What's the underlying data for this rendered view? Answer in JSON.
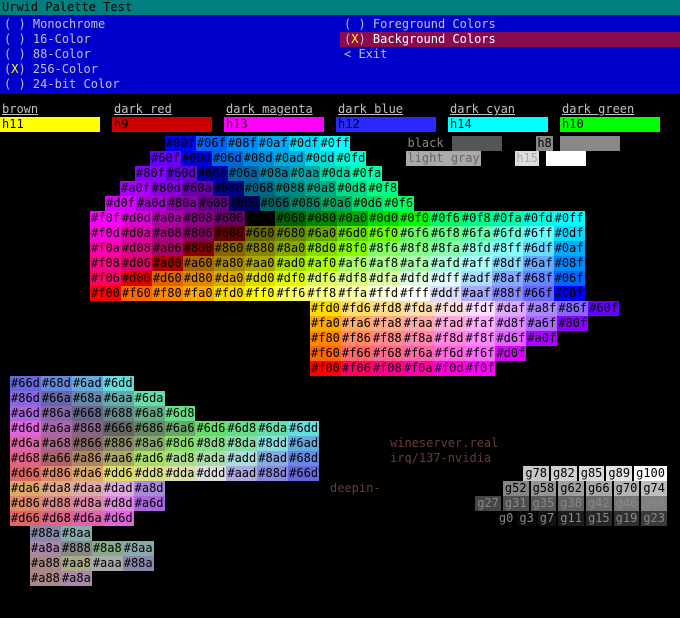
{
  "title": "Urwid Palette Test",
  "menu": {
    "left": [
      {
        "mark": " ",
        "label": "Monochrome"
      },
      {
        "mark": " ",
        "label": "16-Color"
      },
      {
        "mark": " ",
        "label": "88-Color"
      },
      {
        "mark": "X",
        "label": "256-Color"
      },
      {
        "mark": " ",
        "label": "24-bit Color"
      }
    ],
    "right": [
      {
        "mark": " ",
        "label": "Foreground Colors",
        "sel": false
      },
      {
        "mark": "X",
        "label": "Background Colors",
        "sel": true
      },
      {
        "exit": "Exit"
      }
    ]
  },
  "swatches": [
    {
      "name": "brown",
      "code": "h11",
      "bg": "#ffff00"
    },
    {
      "name": "dark red",
      "code": "h9",
      "bg": "#cd0000"
    },
    {
      "name": "dark magenta",
      "code": "h13",
      "bg": "#ff00ff"
    },
    {
      "name": "dark blue",
      "code": "h12",
      "bg": "#2a2aff"
    },
    {
      "name": "dark cyan",
      "code": "h14",
      "bg": "#00ffff"
    },
    {
      "name": "dark green",
      "code": "h10",
      "bg": "#00ff00"
    }
  ],
  "corner_labels": {
    "black": "black",
    "h8": "h8",
    "lg": "light gray",
    "h15": "h15"
  },
  "bg_text": {
    "wineserver": "wineserver.real",
    "irq": "irq/137-nvidia",
    "deepin": "deepin-"
  },
  "grays_top": [
    "g78",
    "g82",
    "g85",
    "g89",
    "g100"
  ],
  "grays2": [
    "g52",
    "g58",
    "g62",
    "g66",
    "g70",
    "g74"
  ],
  "grays3": [
    "g27",
    "g31",
    "g35",
    "g38",
    "g42",
    "g46",
    "g50"
  ],
  "grays4": [
    "g0",
    "g3",
    "g7",
    "g11",
    "g15",
    "g19",
    "g23"
  ],
  "hex_rows": [
    [
      [
        "#00f",
        "#0000ff"
      ],
      [
        "#06f",
        "#0066ff"
      ],
      [
        "#08f",
        "#0088ff"
      ],
      [
        "#0af",
        "#00aaff"
      ],
      [
        "#0df",
        "#00ddff"
      ],
      [
        "#0ff",
        "#00ffff"
      ]
    ],
    [
      [
        "#60f",
        "#6600ff"
      ],
      [
        "#00d",
        "#0000dd"
      ],
      [
        "#06d",
        "#0066dd"
      ],
      [
        "#08d",
        "#0088dd"
      ],
      [
        "#0ad",
        "#00aadd"
      ],
      [
        "#0dd",
        "#00dddd"
      ],
      [
        "#0fd",
        "#00ffdd"
      ]
    ],
    [
      [
        "#80f",
        "#8800ff"
      ],
      [
        "#60d",
        "#6600dd"
      ],
      [
        "#00a",
        "#0000aa"
      ],
      [
        "#06a",
        "#0066aa"
      ],
      [
        "#08a",
        "#0088aa"
      ],
      [
        "#0aa",
        "#00aaaa"
      ],
      [
        "#0da",
        "#00ddaa"
      ],
      [
        "#0fa",
        "#00ffaa"
      ]
    ],
    [
      [
        "#a0f",
        "#aa00ff"
      ],
      [
        "#80d",
        "#8800dd"
      ],
      [
        "#60a",
        "#6600aa"
      ],
      [
        "#008",
        "#000088"
      ],
      [
        "#068",
        "#006688"
      ],
      [
        "#088",
        "#008888"
      ],
      [
        "#0a8",
        "#00aa88"
      ],
      [
        "#0d8",
        "#00dd88"
      ],
      [
        "#0f8",
        "#00ff88"
      ]
    ],
    [
      [
        "#d0f",
        "#dd00ff"
      ],
      [
        "#a0d",
        "#aa00dd"
      ],
      [
        "#80a",
        "#8800aa"
      ],
      [
        "#608",
        "#660088"
      ],
      [
        "#006",
        "#000066"
      ],
      [
        "#066",
        "#006666"
      ],
      [
        "#086",
        "#008866"
      ],
      [
        "#0a6",
        "#00aa66"
      ],
      [
        "#0d6",
        "#00dd66"
      ],
      [
        "#0f6",
        "#00ff66"
      ]
    ],
    [
      [
        "#f0f",
        "#ff00ff"
      ],
      [
        "#d0d",
        "#dd00dd"
      ],
      [
        "#a0a",
        "#aa00aa"
      ],
      [
        "#808",
        "#880088"
      ],
      [
        "#606",
        "#660066"
      ],
      [
        "#000",
        "#000000"
      ],
      [
        "#060",
        "#006600"
      ],
      [
        "#080",
        "#008800"
      ],
      [
        "#0a0",
        "#00aa00"
      ],
      [
        "#0d0",
        "#00dd00"
      ],
      [
        "#0f0",
        "#00ff00"
      ],
      [
        "#0f6",
        "#00ff66"
      ],
      [
        "#0f8",
        "#00ff88"
      ],
      [
        "#0fa",
        "#00ffaa"
      ],
      [
        "#0fd",
        "#00ffdd"
      ],
      [
        "#0ff",
        "#00ffff"
      ]
    ],
    [
      [
        "#f0d",
        "#ff00dd"
      ],
      [
        "#d0a",
        "#dd00aa"
      ],
      [
        "#a08",
        "#aa0088"
      ],
      [
        "#806",
        "#880066"
      ],
      [
        "#600",
        "#660000"
      ],
      [
        "#660",
        "#666600"
      ],
      [
        "#680",
        "#668800"
      ],
      [
        "#6a0",
        "#66aa00"
      ],
      [
        "#6d0",
        "#66dd00"
      ],
      [
        "#6f0",
        "#66ff00"
      ],
      [
        "#6f6",
        "#66ff66"
      ],
      [
        "#6f8",
        "#66ff88"
      ],
      [
        "#6fa",
        "#66ffaa"
      ],
      [
        "#6fd",
        "#66ffdd"
      ],
      [
        "#6ff",
        "#66ffff"
      ],
      [
        "#0df",
        "#00ddff"
      ]
    ],
    [
      [
        "#f0a",
        "#ff00aa"
      ],
      [
        "#d08",
        "#dd0088"
      ],
      [
        "#a06",
        "#aa0066"
      ],
      [
        "#800",
        "#880000"
      ],
      [
        "#860",
        "#886600"
      ],
      [
        "#880",
        "#888800"
      ],
      [
        "#8a0",
        "#88aa00"
      ],
      [
        "#8d0",
        "#88dd00"
      ],
      [
        "#8f0",
        "#88ff00"
      ],
      [
        "#8f6",
        "#88ff66"
      ],
      [
        "#8f8",
        "#88ff88"
      ],
      [
        "#8fa",
        "#88ffaa"
      ],
      [
        "#8fd",
        "#88ffdd"
      ],
      [
        "#8ff",
        "#88ffff"
      ],
      [
        "#6df",
        "#66ddff"
      ],
      [
        "#0af",
        "#00aaff"
      ]
    ],
    [
      [
        "#f08",
        "#ff0088"
      ],
      [
        "#d06",
        "#dd0066"
      ],
      [
        "#a00",
        "#aa0000"
      ],
      [
        "#a60",
        "#aa6600"
      ],
      [
        "#a80",
        "#aa8800"
      ],
      [
        "#aa0",
        "#aaaa00"
      ],
      [
        "#ad0",
        "#aadd00"
      ],
      [
        "#af0",
        "#aaff00"
      ],
      [
        "#af6",
        "#aaff66"
      ],
      [
        "#af8",
        "#aaff88"
      ],
      [
        "#afa",
        "#aaffaa"
      ],
      [
        "#afd",
        "#aaffdd"
      ],
      [
        "#aff",
        "#aaffff"
      ],
      [
        "#8df",
        "#88ddff"
      ],
      [
        "#6af",
        "#66aaff"
      ],
      [
        "#08f",
        "#0088ff"
      ]
    ],
    [
      [
        "#f06",
        "#ff0066"
      ],
      [
        "#d00",
        "#dd0000"
      ],
      [
        "#d60",
        "#dd6600"
      ],
      [
        "#d80",
        "#dd8800"
      ],
      [
        "#da0",
        "#ddaa00"
      ],
      [
        "#dd0",
        "#dddd00"
      ],
      [
        "#df0",
        "#ddff00"
      ],
      [
        "#df6",
        "#ddff66"
      ],
      [
        "#df8",
        "#ddff88"
      ],
      [
        "#dfa",
        "#ddffaa"
      ],
      [
        "#dfd",
        "#ddffdd"
      ],
      [
        "#dff",
        "#ddffff"
      ],
      [
        "#adf",
        "#aaddff"
      ],
      [
        "#8af",
        "#88aaff"
      ],
      [
        "#68f",
        "#6688ff"
      ],
      [
        "#06f",
        "#0066ff"
      ]
    ],
    [
      [
        "#f00",
        "#ff0000"
      ],
      [
        "#f60",
        "#ff6600"
      ],
      [
        "#f80",
        "#ff8800"
      ],
      [
        "#fa0",
        "#ffaa00"
      ],
      [
        "#fd0",
        "#ffdd00"
      ],
      [
        "#ff0",
        "#ffff00"
      ],
      [
        "#ff6",
        "#ffff66"
      ],
      [
        "#ff8",
        "#ffff88"
      ],
      [
        "#ffa",
        "#ffffaa"
      ],
      [
        "#ffd",
        "#ffffdd"
      ],
      [
        "#fff",
        "#ffffff"
      ],
      [
        "#ddf",
        "#ddddff"
      ],
      [
        "#aaf",
        "#aaaaff"
      ],
      [
        "#88f",
        "#8888ff"
      ],
      [
        "#66f",
        "#6666ff"
      ],
      [
        "#00f",
        "#0000ff"
      ]
    ],
    [
      [
        "#fd0",
        "#ffdd00"
      ],
      [
        "#fd6",
        "#ffdd66"
      ],
      [
        "#fd8",
        "#ffdd88"
      ],
      [
        "#fda",
        "#ffddaa"
      ],
      [
        "#fdd",
        "#ffdddd"
      ],
      [
        "#fdf",
        "#ffddff"
      ],
      [
        "#daf",
        "#ddaaff"
      ],
      [
        "#a8f",
        "#aa88ff"
      ],
      [
        "#86f",
        "#8866ff"
      ],
      [
        "#60f",
        "#6600ff"
      ]
    ],
    [
      [
        "#fa0",
        "#ffaa00"
      ],
      [
        "#fa6",
        "#ffaa66"
      ],
      [
        "#fa8",
        "#ffaa88"
      ],
      [
        "#faa",
        "#ffaaaa"
      ],
      [
        "#fad",
        "#ffaadd"
      ],
      [
        "#faf",
        "#ffaaff"
      ],
      [
        "#d8f",
        "#dd88ff"
      ],
      [
        "#a6f",
        "#aa66ff"
      ],
      [
        "#80f",
        "#8800ff"
      ]
    ],
    [
      [
        "#f80",
        "#ff8800"
      ],
      [
        "#f86",
        "#ff8866"
      ],
      [
        "#f88",
        "#ff8888"
      ],
      [
        "#f8a",
        "#ff88aa"
      ],
      [
        "#f8d",
        "#ff88dd"
      ],
      [
        "#f8f",
        "#ff88ff"
      ],
      [
        "#d6f",
        "#dd66ff"
      ],
      [
        "#a0f",
        "#aa00ff"
      ]
    ],
    [
      [
        "#f60",
        "#ff6600"
      ],
      [
        "#f66",
        "#ff6666"
      ],
      [
        "#f68",
        "#ff6688"
      ],
      [
        "#f6a",
        "#ff66aa"
      ],
      [
        "#f6d",
        "#ff66dd"
      ],
      [
        "#f6f",
        "#ff66ff"
      ],
      [
        "#d0f",
        "#dd00ff"
      ]
    ],
    [
      [
        "#f00",
        "#ff0000"
      ],
      [
        "#f06",
        "#ff0066"
      ],
      [
        "#f08",
        "#ff0088"
      ],
      [
        "#f0a",
        "#ff00aa"
      ],
      [
        "#f0d",
        "#ff00dd"
      ],
      [
        "#f0f",
        "#ff00ff"
      ]
    ]
  ],
  "left_block": [
    [
      [
        "#66d",
        "#6666dd"
      ],
      [
        "#68d",
        "#6688dd"
      ],
      [
        "#6ad",
        "#66aadd"
      ],
      [
        "#6dd",
        "#66dddd"
      ]
    ],
    [
      [
        "#86d",
        "#8866dd"
      ],
      [
        "#66a",
        "#6666aa"
      ],
      [
        "#68a",
        "#6688aa"
      ],
      [
        "#6aa",
        "#66aaaa"
      ],
      [
        "#6da",
        "#66ddaa"
      ]
    ],
    [
      [
        "#a6d",
        "#aa66dd"
      ],
      [
        "#86a",
        "#8866aa"
      ],
      [
        "#668",
        "#666688"
      ],
      [
        "#688",
        "#668888"
      ],
      [
        "#6a8",
        "#66aa88"
      ],
      [
        "#6d8",
        "#66dd88"
      ]
    ],
    [
      [
        "#d6d",
        "#dd66dd"
      ],
      [
        "#a6a",
        "#aa66aa"
      ],
      [
        "#868",
        "#886688"
      ],
      [
        "#666",
        "#666666"
      ],
      [
        "#686",
        "#668866"
      ],
      [
        "#6a6",
        "#66aa66"
      ],
      [
        "#6d6",
        "#66dd66"
      ],
      [
        "#6d8",
        "#66dd88"
      ],
      [
        "#6da",
        "#66ddaa"
      ],
      [
        "#6dd",
        "#66dddd"
      ]
    ],
    [
      [
        "#d6a",
        "#dd66aa"
      ],
      [
        "#a68",
        "#aa6688"
      ],
      [
        "#866",
        "#886666"
      ],
      [
        "#886",
        "#888866"
      ],
      [
        "#8a6",
        "#88aa66"
      ],
      [
        "#8d6",
        "#88dd66"
      ],
      [
        "#8d8",
        "#88dd88"
      ],
      [
        "#8da",
        "#88ddaa"
      ],
      [
        "#8dd",
        "#88dddd"
      ],
      [
        "#6ad",
        "#66aadd"
      ]
    ],
    [
      [
        "#d68",
        "#dd6688"
      ],
      [
        "#a66",
        "#aa6666"
      ],
      [
        "#a86",
        "#aa8866"
      ],
      [
        "#aa6",
        "#aaaa66"
      ],
      [
        "#ad6",
        "#aadd66"
      ],
      [
        "#ad8",
        "#aadd88"
      ],
      [
        "#ada",
        "#aaddaa"
      ],
      [
        "#add",
        "#aadddd"
      ],
      [
        "#8ad",
        "#88aadd"
      ],
      [
        "#68d",
        "#6688dd"
      ]
    ],
    [
      [
        "#d66",
        "#dd6666"
      ],
      [
        "#d86",
        "#dd8866"
      ],
      [
        "#da6",
        "#ddaa66"
      ],
      [
        "#dd6",
        "#dddd66"
      ],
      [
        "#dd8",
        "#dddd88"
      ],
      [
        "#dda",
        "#ddddaa"
      ],
      [
        "#ddd",
        "#dddddd"
      ],
      [
        "#aad",
        "#aaaadd"
      ],
      [
        "#88d",
        "#8888dd"
      ],
      [
        "#66d",
        "#6666dd"
      ]
    ],
    [
      [
        "#da6",
        "#ddaa66"
      ],
      [
        "#da8",
        "#ddaa88"
      ],
      [
        "#daa",
        "#ddaaaa"
      ],
      [
        "#dad",
        "#ddaadd"
      ],
      [
        "#a8d",
        "#aa88dd"
      ]
    ],
    [
      [
        "#d86",
        "#dd8866"
      ],
      [
        "#d88",
        "#dd8888"
      ],
      [
        "#d8a",
        "#dd88aa"
      ],
      [
        "#d8d",
        "#dd88dd"
      ],
      [
        "#a6d",
        "#aa66dd"
      ]
    ],
    [
      [
        "#d66",
        "#dd6666"
      ],
      [
        "#d68",
        "#dd6688"
      ],
      [
        "#d6a",
        "#dd66aa"
      ],
      [
        "#d6d",
        "#dd66dd"
      ]
    ]
  ],
  "tail": [
    [
      [
        "#88a",
        "#8888aa"
      ],
      [
        "#8aa",
        "#88aaaa"
      ]
    ],
    [
      [
        "#a8a",
        "#aa88aa"
      ],
      [
        "#888",
        "#888888"
      ],
      [
        "#8a8",
        "#88aa88"
      ],
      [
        "#8aa",
        "#88aaaa"
      ]
    ],
    [
      [
        "#a88",
        "#aa8888"
      ],
      [
        "#aa8",
        "#aaaa88"
      ],
      [
        "#aaa",
        "#aaaaaa"
      ],
      [
        "#88a",
        "#8888aa"
      ]
    ],
    [
      [
        "#a88",
        "#aa8888"
      ],
      [
        "#a8a",
        "#aa88aa"
      ]
    ]
  ]
}
